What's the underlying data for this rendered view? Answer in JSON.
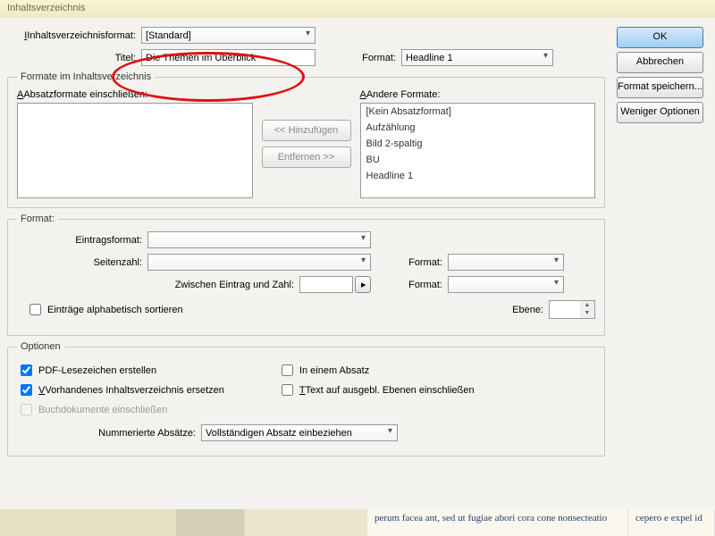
{
  "titlebar": "Inhaltsverzeichnis",
  "fmt": {
    "label": "Inhaltsverzeichnisformat:",
    "value": "[Standard]"
  },
  "title": {
    "label": "Titel:",
    "value": "Die Themen im Überblick"
  },
  "titleFmt": {
    "label": "Format:",
    "value": "Headline 1"
  },
  "grp1": {
    "legend": "Formate im Inhaltsverzeichnis",
    "leftLabel": "Absatzformate einschließen:",
    "rightLabel": "Andere Formate:",
    "add": "<<  Hinzufügen",
    "remove": "Entfernen >>",
    "items": [
      "[Kein Absatzformat]",
      "Aufzählung",
      "Bild 2-spaltig",
      "BU",
      "Headline 1"
    ]
  },
  "grp2": {
    "legend": "Format:",
    "entry": "Eintragsformat:",
    "page": "Seitenzahl:",
    "between": "Zwischen Eintrag und Zahl:",
    "fmt": "Format:",
    "level": "Ebene:",
    "alpha": "Einträge alphabetisch sortieren"
  },
  "grp3": {
    "legend": "Optionen",
    "pdf": "PDF-Lesezeichen erstellen",
    "replace": "Vorhandenes Inhaltsverzeichnis ersetzen",
    "book": "Buchdokumente einschließen",
    "onepara": "In einem Absatz",
    "hidden": "Text auf ausgebl. Ebenen einschließen",
    "num": "Nummerierte Absätze:",
    "numval": "Vollständigen Absatz einbeziehen"
  },
  "buttons": {
    "ok": "OK",
    "cancel": "Abbrechen",
    "save": "Format speichern...",
    "less": "Weniger Optionen"
  },
  "footer": {
    "a": "perum facea ant, sed ut fugiae abori cora cone nonsecteatio",
    "b": "cepero e expel id"
  }
}
